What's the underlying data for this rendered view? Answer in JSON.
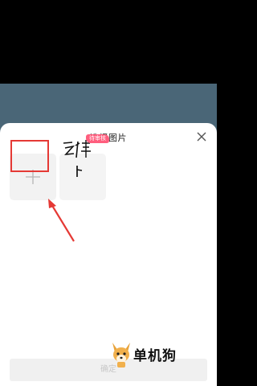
{
  "sheet": {
    "title": "选择图片",
    "close_icon": "close-icon",
    "add_icon": "plus-icon"
  },
  "image_item": {
    "badge": "待审核",
    "handwriting": "乏 修 卜"
  },
  "footer": {
    "confirm_label": "确定"
  },
  "watermark": {
    "text": "单机狗"
  },
  "colors": {
    "backdrop": "#4a6677",
    "highlight": "#e53935",
    "badge": "#ff5e7e"
  }
}
